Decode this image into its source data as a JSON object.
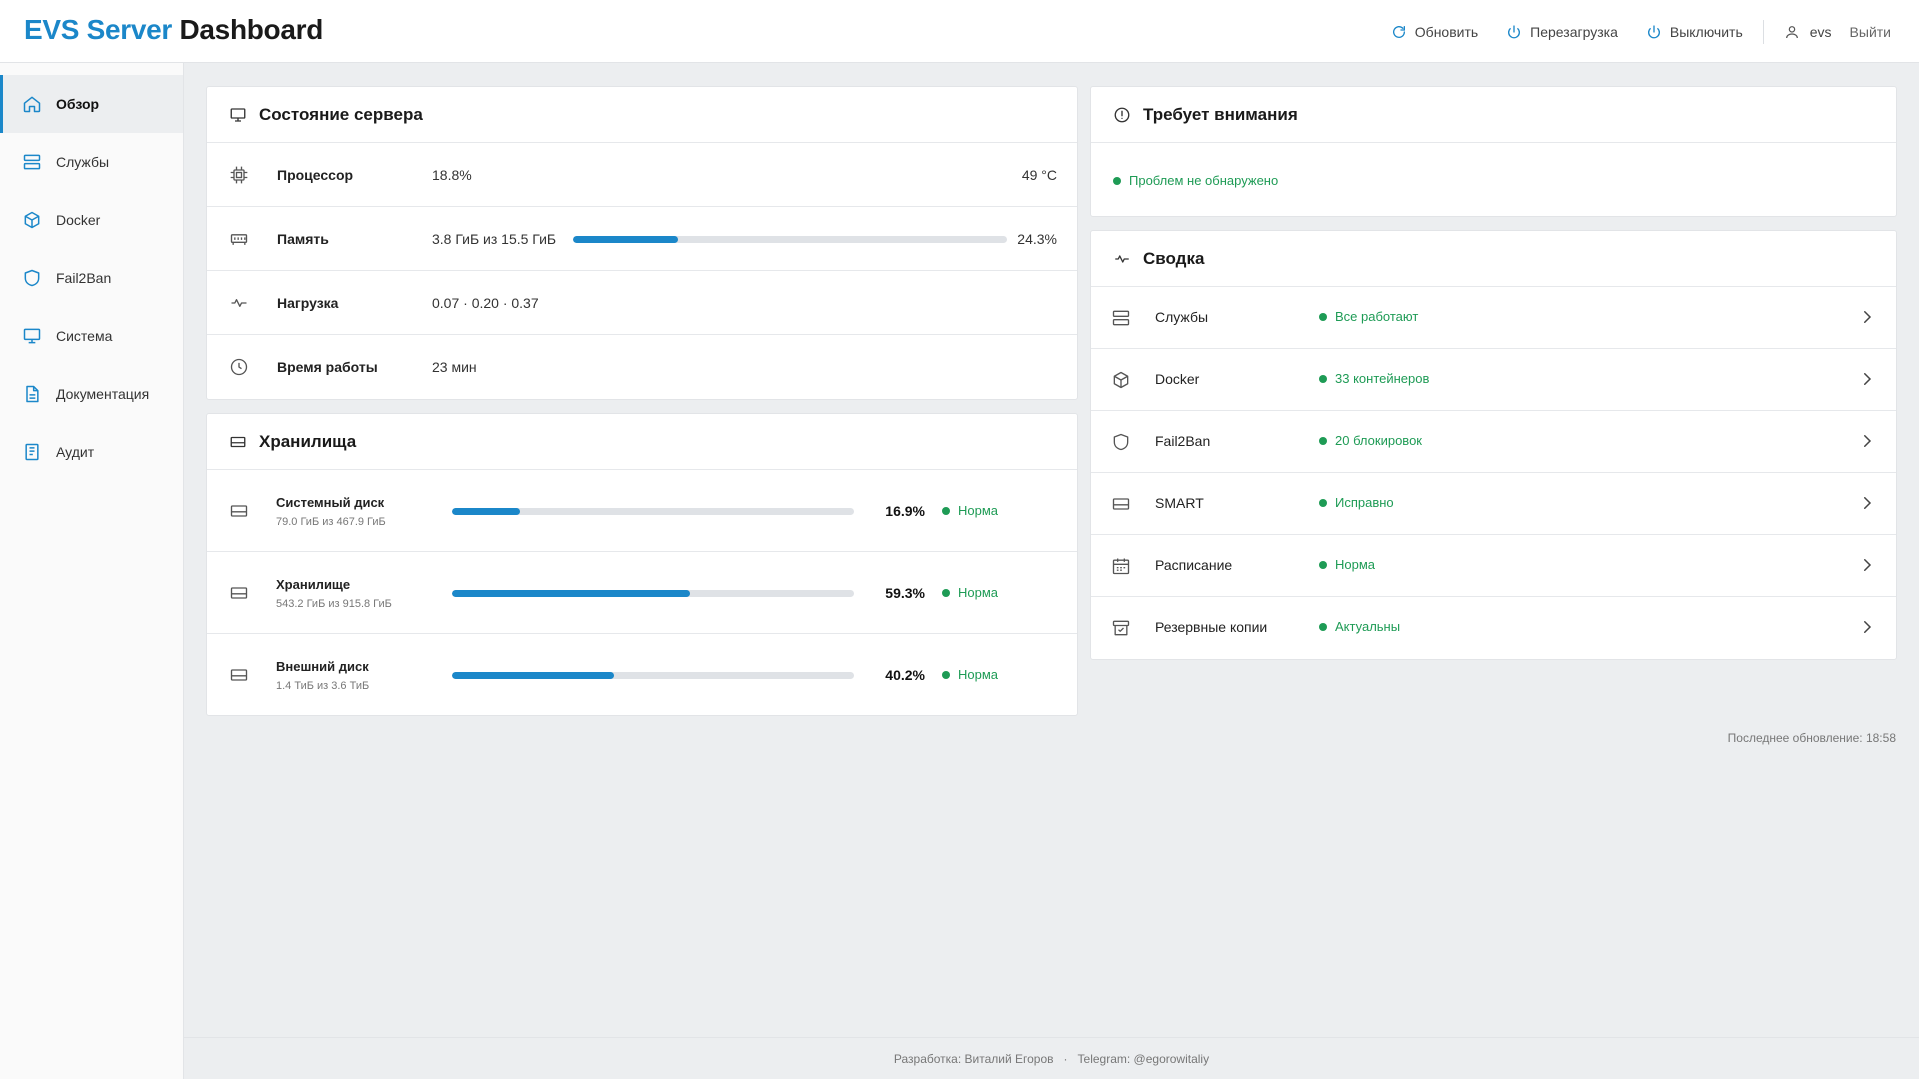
{
  "app": {
    "brand_part1": "EVS Server",
    "brand_part2": "Dashboard",
    "accent_color": "#1b87c9",
    "ok_color": "#1e9b55"
  },
  "header": {
    "refresh_label": "Обновить",
    "reboot_label": "Перезагрузка",
    "shutdown_label": "Выключить",
    "username": "evs",
    "logout_label": "Выйти"
  },
  "sidebar": {
    "items": [
      {
        "label": "Обзор",
        "icon": "home-icon",
        "active": true
      },
      {
        "label": "Службы",
        "icon": "server-icon"
      },
      {
        "label": "Docker",
        "icon": "box-icon"
      },
      {
        "label": "Fail2Ban",
        "icon": "shield-icon"
      },
      {
        "label": "Система",
        "icon": "monitor-icon"
      },
      {
        "label": "Документация",
        "icon": "document-icon"
      },
      {
        "label": "Аудит",
        "icon": "audit-icon"
      }
    ]
  },
  "server_state": {
    "title": "Состояние сервера",
    "cpu": {
      "label": "Процессор",
      "value": "18.8%",
      "temp": "49 °C"
    },
    "memory": {
      "label": "Память",
      "value": "3.8 ГиБ из 15.5 ГиБ",
      "percent_text": "24.3%",
      "percent": 24.3
    },
    "load": {
      "label": "Нагрузка",
      "value": "0.07 · 0.20 · 0.37"
    },
    "uptime": {
      "label": "Время работы",
      "value": "23 мин"
    }
  },
  "storage": {
    "title": "Хранилища",
    "disks": [
      {
        "name": "Системный диск",
        "sub": "79.0 ГиБ из 467.9 ГиБ",
        "percent": 16.9,
        "percent_text": "16.9%",
        "status": "Норма"
      },
      {
        "name": "Хранилище",
        "sub": "543.2 ГиБ из 915.8 ГиБ",
        "percent": 59.3,
        "percent_text": "59.3%",
        "status": "Норма"
      },
      {
        "name": "Внешний диск",
        "sub": "1.4 ТиБ из 3.6 ТиБ",
        "percent": 40.2,
        "percent_text": "40.2%",
        "status": "Норма"
      }
    ]
  },
  "attention": {
    "title": "Требует внимания",
    "message": "Проблем не обнаружено"
  },
  "summary": {
    "title": "Сводка",
    "rows": [
      {
        "label": "Службы",
        "status": "Все работают",
        "icon": "server-icon"
      },
      {
        "label": "Docker",
        "status": "33 контейнеров",
        "icon": "box-icon"
      },
      {
        "label": "Fail2Ban",
        "status": "20 блокировок",
        "icon": "shield-icon"
      },
      {
        "label": "SMART",
        "status": "Исправно",
        "icon": "hard-drive-icon"
      },
      {
        "label": "Расписание",
        "status": "Норма",
        "icon": "calendar-icon"
      },
      {
        "label": "Резервные копии",
        "status": "Актуальны",
        "icon": "archive-icon"
      }
    ]
  },
  "last_update": "Последнее обновление: 18:58",
  "footer": {
    "developer": "Разработка: Виталий Егоров",
    "separator": "·",
    "telegram": "Telegram: @egorowitaliy"
  }
}
